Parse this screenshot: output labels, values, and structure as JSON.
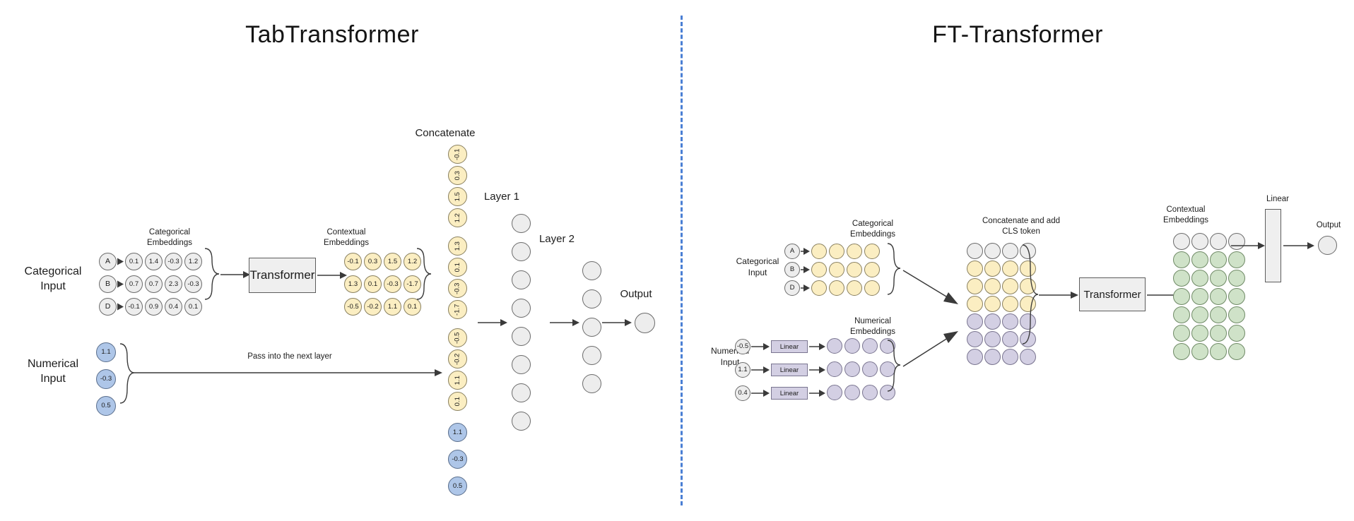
{
  "divider": {
    "color": "#4a7fd4"
  },
  "left": {
    "title": "TabTransformer",
    "categorical_input_label": "Categorical\nInput",
    "numerical_input_label": "Numerical\nInput",
    "categorical_embeddings_label": "Categorical\nEmbeddings",
    "contextual_embeddings_label": "Contextual\nEmbeddings",
    "concatenate_label": "Concatenate",
    "transformer_label": "Transformer",
    "pass_label": "Pass into the next layer",
    "layer1_label": "Layer 1",
    "layer2_label": "Layer 2",
    "output_label": "Output",
    "categories": [
      "A",
      "B",
      "D"
    ],
    "categorical_embeddings": [
      [
        "0.1",
        "1.4",
        "-0.3",
        "1.2"
      ],
      [
        "0.7",
        "0.7",
        "2.3",
        "-0.3"
      ],
      [
        "-0.1",
        "0.9",
        "0.4",
        "0.1"
      ]
    ],
    "contextual_embeddings": [
      [
        "-0.1",
        "0.3",
        "1.5",
        "1.2"
      ],
      [
        "1.3",
        "0.1",
        "-0.3",
        "-1.7"
      ],
      [
        "-0.5",
        "-0.2",
        "1.1",
        "0.1"
      ]
    ],
    "numerical_values": [
      "1.1",
      "-0.3",
      "0.5"
    ],
    "concatenated_contextual": [
      "-0.1",
      "0.3",
      "1.5",
      "1.2",
      "1.3",
      "0.1",
      "-0.3",
      "-1.7",
      "-0.5",
      "-0.2",
      "1.1",
      "0.1"
    ],
    "concatenated_numerical": [
      "1.1",
      "-0.3",
      "0.5"
    ],
    "layer1_units": 8,
    "layer2_units": 5,
    "output_units": 1
  },
  "right": {
    "title": "FT-Transformer",
    "categorical_input_label": "Categorical\nInput",
    "numerical_input_label": "Numerical\nInput",
    "categorical_embeddings_label": "Categorical\nEmbeddings",
    "numerical_embeddings_label": "Numerical\nEmbeddings",
    "concatenate_label": "Concatenate and add\nCLS token",
    "contextual_embeddings_label": "Contextual\nEmbeddings",
    "transformer_label": "Transformer",
    "linear_label": "Linear",
    "linear_box_label": "Linear",
    "output_label": "Output",
    "categories": [
      "A",
      "B",
      "D"
    ],
    "numerical_values": [
      "-0.5",
      "1.1",
      "0.4"
    ],
    "cat_embed_rows": 3,
    "cat_embed_cols": 4,
    "num_embed_rows": 3,
    "num_embed_cols": 4,
    "concat_rows": [
      {
        "type": "cls",
        "cols": 4
      },
      {
        "type": "categorical",
        "cols": 4
      },
      {
        "type": "categorical",
        "cols": 4
      },
      {
        "type": "categorical",
        "cols": 4
      },
      {
        "type": "numerical",
        "cols": 4
      },
      {
        "type": "numerical",
        "cols": 4
      },
      {
        "type": "numerical",
        "cols": 4
      }
    ],
    "contextual_rows": [
      {
        "type": "cls",
        "cols": 4
      },
      {
        "type": "token",
        "cols": 4
      },
      {
        "type": "token",
        "cols": 4
      },
      {
        "type": "token",
        "cols": 4
      },
      {
        "type": "token",
        "cols": 4
      },
      {
        "type": "token",
        "cols": 4
      },
      {
        "type": "token",
        "cols": 4
      }
    ]
  },
  "colors": {
    "gray": "#ededed",
    "yellow": "#fbeec2",
    "blue": "#aec6e8",
    "purple": "#d3cfe3",
    "green": "#cfe2c8",
    "divider": "#4a7fd4"
  }
}
